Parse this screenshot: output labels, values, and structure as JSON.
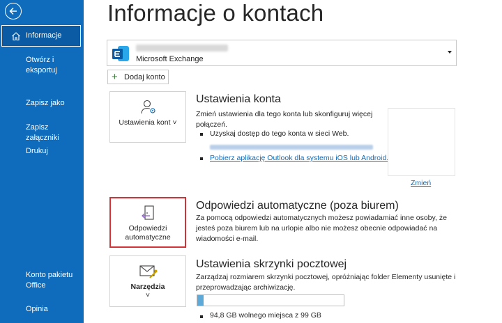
{
  "sidebar": {
    "items": [
      {
        "label": "Informacje"
      },
      {
        "label": "Otwórz i eksportuj"
      },
      {
        "label": "Zapisz jako"
      },
      {
        "label": "Zapisz załączniki"
      },
      {
        "label": "Drukuj"
      },
      {
        "label": "Konto pakietu Office"
      },
      {
        "label": "Opinia"
      }
    ]
  },
  "page": {
    "title": "Informacje o kontach"
  },
  "account": {
    "type": "Microsoft Exchange"
  },
  "add_account": {
    "label": "Dodaj konto"
  },
  "sections": {
    "settings": {
      "tile_label": "Ustawienia kont ˅",
      "title": "Ustawienia konta",
      "description": "Zmień ustawienia dla tego konta lub skonfiguruj więcej połączeń.",
      "bullet1": "Uzyskaj dostęp do tego konta w sieci Web.",
      "bullet3_link": "Pobierz aplikację Outlook dla systemu iOS lub Android.",
      "change_link": "Zmień"
    },
    "auto_reply": {
      "tile_label": "Odpowiedzi automatyczne",
      "title": "Odpowiedzi automatyczne (poza biurem)",
      "description": "Za pomocą odpowiedzi automatycznych możesz powiadamiać inne osoby, że jesteś poza biurem lub na urlopie albo nie możesz obecnie odpowiadać na wiadomości e-mail."
    },
    "mailbox": {
      "tile_label": "Narzędzia",
      "tile_chevron": "˅",
      "title": "Ustawienia skrzynki pocztowej",
      "description": "Zarządzaj rozmiarem skrzynki pocztowej, opróżniając folder Elementy usunięte i przeprowadzając archiwizację.",
      "quota_text": "94,8 GB wolnego miejsca z 99 GB",
      "used_fraction": 0.042
    }
  },
  "colors": {
    "sidebar": "#0f6cbd",
    "accent_red": "#d13438",
    "link": "#0f6cbd"
  }
}
